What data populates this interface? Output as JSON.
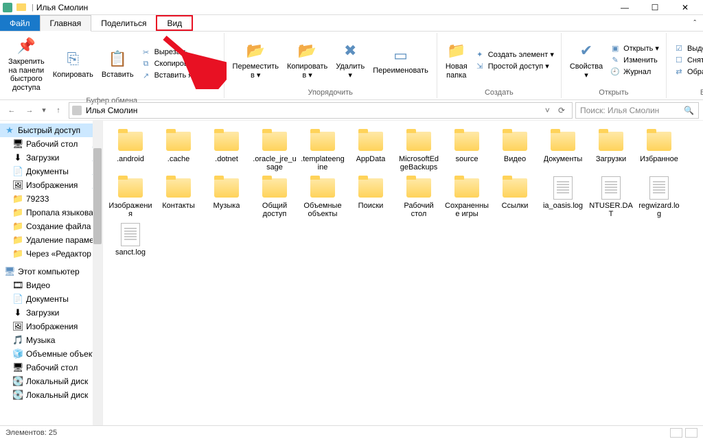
{
  "window": {
    "title": "Илья Смолин"
  },
  "tabs": {
    "file": "Файл",
    "home": "Главная",
    "share": "Поделиться",
    "view": "Вид"
  },
  "ribbon": {
    "pin": "Закрепить на панели\nбыстрого доступа",
    "copy": "Копировать",
    "paste": "Вставить",
    "cut": "Вырезать",
    "copyPath": "Скопировать путь",
    "pasteShortcut": "Вставить ярлык",
    "clipboard": "Буфер обмена",
    "moveTo": "Переместить\nв ▾",
    "copyTo": "Копировать\nв ▾",
    "delete": "Удалить\n▾",
    "rename": "Переименовать",
    "organize": "Упорядочить",
    "newFolder": "Новая\nпапка",
    "newItem": "Создать элемент ▾",
    "easyAccess": "Простой доступ ▾",
    "create": "Создать",
    "properties": "Свойства\n▾",
    "openBtn": "Открыть ▾",
    "edit": "Изменить",
    "history": "Журнал",
    "open": "Открыть",
    "selectAll": "Выделить все",
    "selectNone": "Снять выделение",
    "invert": "Обратить выделение",
    "select": "Выделить"
  },
  "address": {
    "path": "Илья Смолин",
    "searchPlaceholder": "Поиск: Илья Смолин"
  },
  "sidebar": {
    "quickAccess": "Быстрый доступ",
    "items1": [
      "Рабочий стол",
      "Загрузки",
      "Документы",
      "Изображения",
      "79233",
      "Пропала языковая",
      "Создание файла",
      "Удаление параметра",
      "Через «Редактор"
    ],
    "thisPC": "Этот компьютер",
    "items2": [
      "Видео",
      "Документы",
      "Загрузки",
      "Изображения",
      "Музыка",
      "Объемные объекты",
      "Рабочий стол",
      "Локальный диск",
      "Локальный диск"
    ]
  },
  "files": [
    {
      "n": ".android",
      "t": "folder"
    },
    {
      "n": ".cache",
      "t": "folder"
    },
    {
      "n": ".dotnet",
      "t": "folder"
    },
    {
      "n": ".oracle_jre_usage",
      "t": "folder"
    },
    {
      "n": ".templateengine",
      "t": "folder"
    },
    {
      "n": "AppData",
      "t": "folder"
    },
    {
      "n": "MicrosoftEdgeBackups",
      "t": "folder"
    },
    {
      "n": "source",
      "t": "folder"
    },
    {
      "n": "Видео",
      "t": "folder"
    },
    {
      "n": "Документы",
      "t": "folder"
    },
    {
      "n": "Загрузки",
      "t": "folder"
    },
    {
      "n": "Избранное",
      "t": "folder"
    },
    {
      "n": "Изображения",
      "t": "folder"
    },
    {
      "n": "Контакты",
      "t": "folder"
    },
    {
      "n": "Музыка",
      "t": "folder"
    },
    {
      "n": "Общий доступ",
      "t": "folder"
    },
    {
      "n": "Объемные объекты",
      "t": "folder"
    },
    {
      "n": "Поиски",
      "t": "folder"
    },
    {
      "n": "Рабочий стол",
      "t": "folder"
    },
    {
      "n": "Сохраненные игры",
      "t": "folder"
    },
    {
      "n": "Ссылки",
      "t": "folder"
    },
    {
      "n": "ia_oasis.log",
      "t": "doc"
    },
    {
      "n": "NTUSER.DAT",
      "t": "doc"
    },
    {
      "n": "regwizard.log",
      "t": "doc"
    },
    {
      "n": "sanct.log",
      "t": "doc"
    }
  ],
  "status": {
    "count": "Элементов: 25"
  }
}
